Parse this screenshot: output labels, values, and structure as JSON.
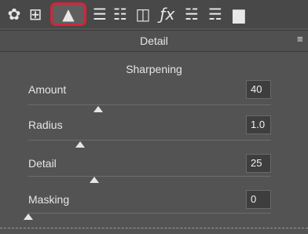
{
  "toolbar": {
    "tools": [
      {
        "icon": "basic-aperture-icon",
        "glyph": "✿",
        "active": false
      },
      {
        "icon": "tone-curve-grid-icon",
        "glyph": "⊞",
        "active": false
      },
      {
        "icon": "detail-mountains-icon",
        "glyph": "▲",
        "active": true
      },
      {
        "icon": "hsl-icon",
        "glyph": "☰",
        "active": false
      },
      {
        "icon": "split-toning-icon",
        "glyph": "☷",
        "active": false
      },
      {
        "icon": "lens-corrections-icon",
        "glyph": "◫",
        "active": false
      },
      {
        "icon": "fx-effects-icon",
        "glyph": "ƒx",
        "active": false
      },
      {
        "icon": "camera-calibration-icon",
        "glyph": "☵",
        "active": false
      },
      {
        "icon": "presets-sliders-icon",
        "glyph": "☴",
        "active": false
      },
      {
        "icon": "snapshots-icon",
        "glyph": "▆",
        "active": false
      }
    ]
  },
  "header": {
    "title": "Detail",
    "menu_icon": "panel-menu-icon"
  },
  "section": {
    "title": "Sharpening"
  },
  "rows": [
    {
      "label": "Amount",
      "value": "40",
      "slider_fraction": 0.27
    },
    {
      "label": "Radius",
      "value": "1.0",
      "slider_fraction": 0.2
    },
    {
      "label": "Detail",
      "value": "25",
      "slider_fraction": 0.25
    },
    {
      "label": "Masking",
      "value": "0",
      "slider_fraction": 0.0
    }
  ],
  "colors": {
    "active_tool_border": "#d0263a",
    "panel_bg": "#535353"
  }
}
